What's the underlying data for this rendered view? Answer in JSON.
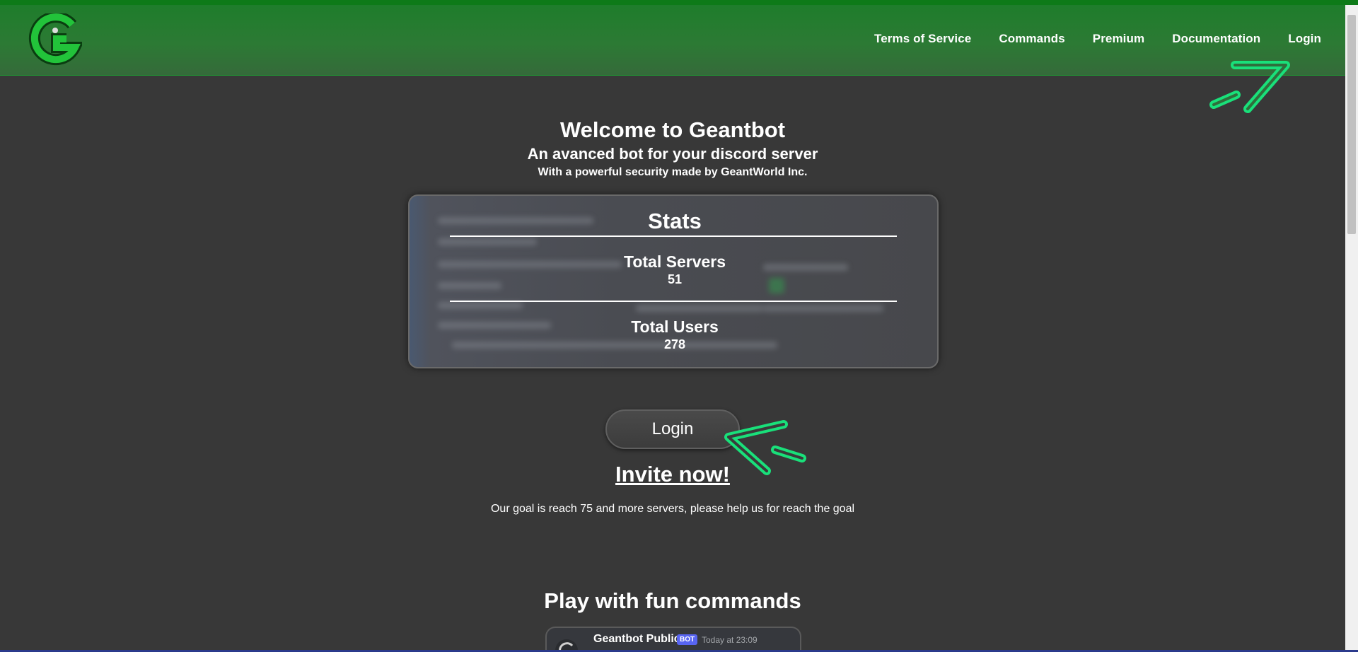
{
  "header": {
    "nav": [
      {
        "label": "Terms of Service"
      },
      {
        "label": "Commands"
      },
      {
        "label": "Premium"
      },
      {
        "label": "Documentation"
      },
      {
        "label": "Login"
      }
    ]
  },
  "hero": {
    "title": "Welcome to Geantbot",
    "subtitle": "An avanced bot for your discord server",
    "tagline": "With a powerful security made by GeantWorld Inc."
  },
  "stats": {
    "title": "Stats",
    "servers_label": "Total Servers",
    "servers_value": "51",
    "users_label": "Total Users",
    "users_value": "278"
  },
  "actions": {
    "login_label": "Login",
    "invite_label": "Invite now!",
    "goal_text": "Our goal is reach 75 and more servers, please help us for reach the goal"
  },
  "features": {
    "title": "Play with fun commands",
    "preview": {
      "bot_name": "Geantbot Public",
      "badge": "BOT",
      "timestamp": "Today at 23:09"
    }
  },
  "colors": {
    "header_green": "#2c7a34",
    "logo_green": "#22c33a",
    "annotation_green": "#19e07a",
    "background": "#383838"
  },
  "icons": {
    "logo": "geantbot-g-logo",
    "annotation_nav": "arrow-annotation",
    "annotation_login": "arrow-annotation"
  }
}
